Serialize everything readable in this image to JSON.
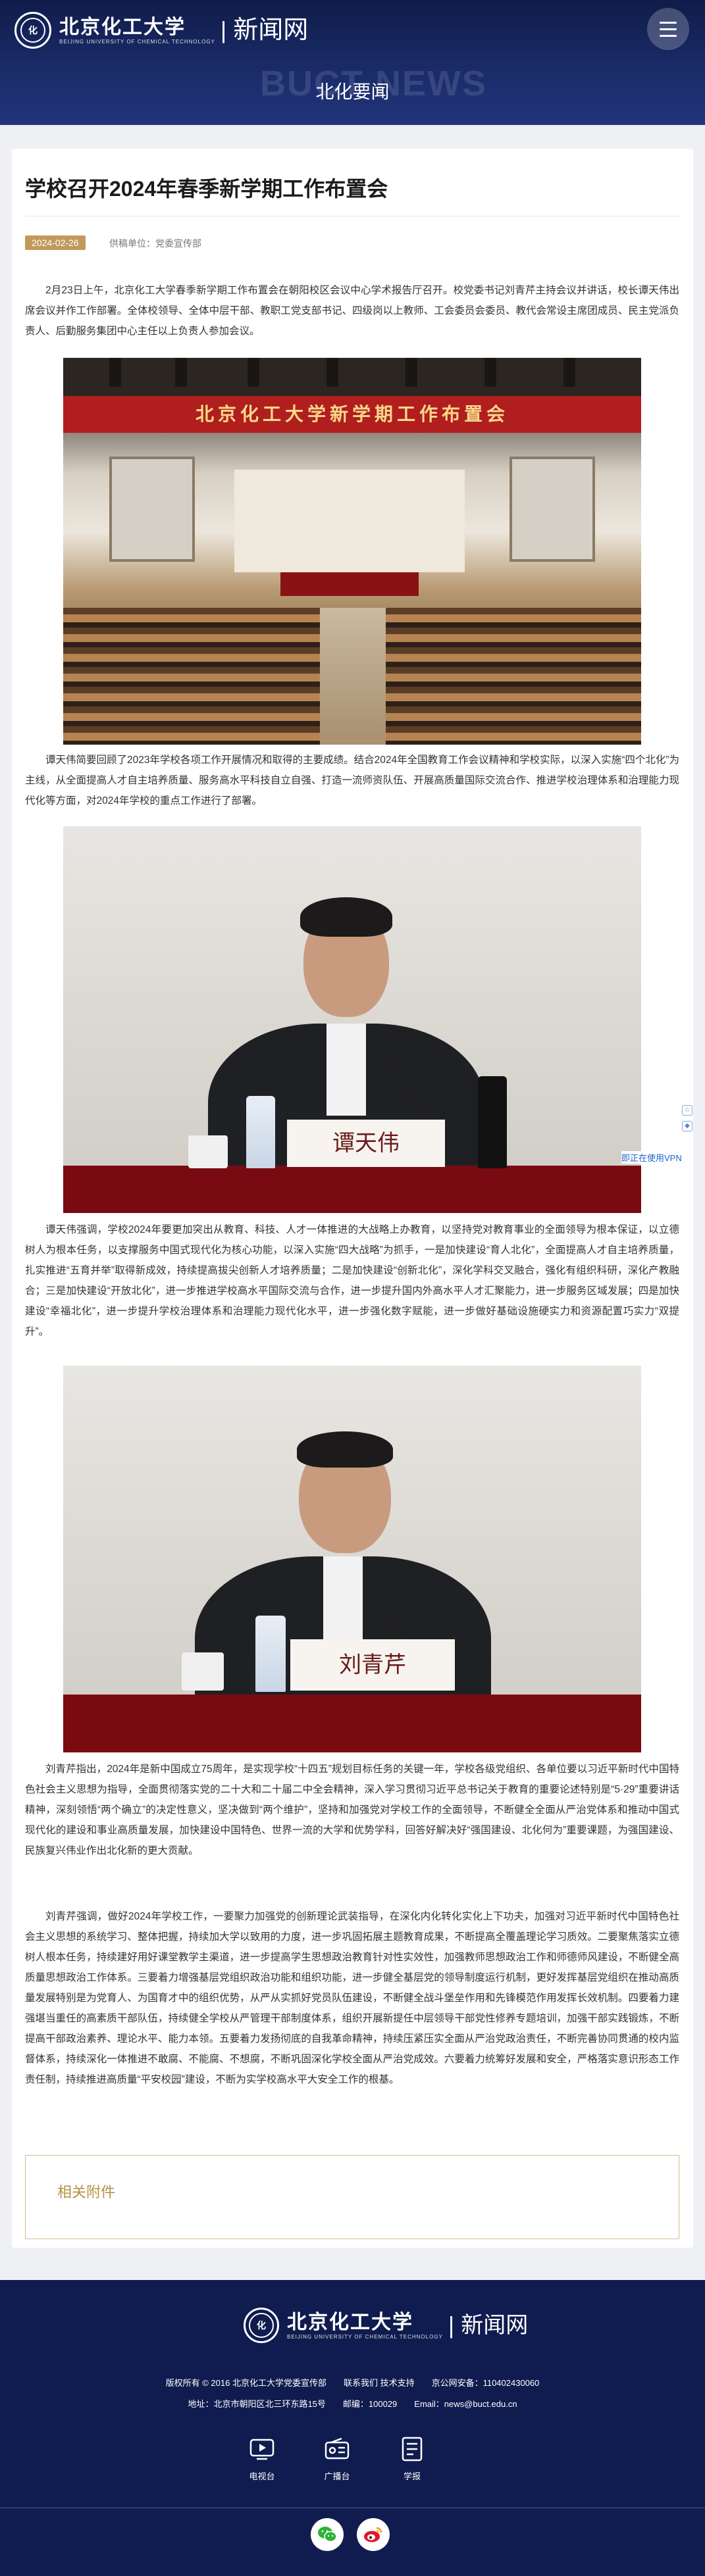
{
  "header": {
    "logo_cn": "北京化工大学",
    "logo_en": "BEIJING UNIVERSITY OF CHEMICAL TECHNOLOGY",
    "site_name": "新闻网",
    "watermark": "BUCT NEWS",
    "section_title": "北化要闻"
  },
  "article": {
    "title": "学校召开2024年春季新学期工作布置会",
    "date": "2024-02-26",
    "source": "供稿单位：党委宣传部",
    "paragraphs": [
      "2月23日上午，北京化工大学春季新学期工作布置会在朝阳校区会议中心学术报告厅召开。校党委书记刘青芹主持会议并讲话，校长谭天伟出席会议并作工作部署。全体校领导、全体中层干部、教职工党支部书记、四级岗以上教师、工会委员会委员、教代会常设主席团成员、民主党派负责人、后勤服务集团中心主任以上负责人参加会议。",
      "谭天伟简要回顾了2023年学校各项工作开展情况和取得的主要成绩。结合2024年全国教育工作会议精神和学校实际，以深入实施“四个北化”为主线，从全面提高人才自主培养质量、服务高水平科技自立自强、打造一流师资队伍、开展高质量国际交流合作、推进学校治理体系和治理能力现代化等方面，对2024年学校的重点工作进行了部署。",
      "谭天伟强调，学校2024年要更加突出从教育、科技、人才一体推进的大战略上办教育，以坚持党对教育事业的全面领导为根本保证，以立德树人为根本任务，以支撑服务中国式现代化为核心功能，以深入实施“四大战略”为抓手，一是加快建设“育人北化”，全面提高人才自主培养质量，扎实推进“五育并举”取得新成效，持续提高拔尖创新人才培养质量；二是加快建设“创新北化”，深化学科交叉融合，强化有组织科研，深化产教融合；三是加快建设“开放北化”，进一步推进学校高水平国际交流与合作，进一步提升国内外高水平人才汇聚能力，进一步服务区域发展；四是加快建设“幸福北化”，进一步提升学校治理体系和治理能力现代化水平，进一步强化数字赋能，进一步做好基础设施硬实力和资源配置巧实力“双提升”。",
      "刘青芹指出，2024年是新中国成立75周年，是实现学校“十四五”规划目标任务的关键一年，学校各级党组织、各单位要以习近平新时代中国特色社会主义思想为指导，全面贯彻落实党的二十大和二十届二中全会精神，深入学习贯彻习近平总书记关于教育的重要论述特别是“5·29”重要讲话精神，深刻领悟“两个确立”的决定性意义，坚决做到“两个维护”，坚持和加强党对学校工作的全面领导，不断健全全面从严治党体系和推动中国式现代化的建设和事业高质量发展，加快建设中国特色、世界一流的大学和优势学科，回答好解决好“强国建设、北化何为”重要课题，为强国建设、民族复兴伟业作出北化新的更大贡献。",
      "刘青芹强调，做好2024年学校工作，一要聚力加强党的创新理论武装指导，在深化内化转化实化上下功夫，加强对习近平新时代中国特色社会主义思想的系统学习、整体把握，持续加大学以致用的力度，进一步巩固拓展主题教育成果，不断提高全覆盖理论学习质效。二要聚焦落实立德树人根本任务，持续建好用好课堂教学主渠道，进一步提高学生思想政治教育针对性实效性，加强教师思想政治工作和师德师风建设，不断健全高质量思想政治工作体系。三要着力增强基层党组织政治功能和组织功能，进一步健全基层党的领导制度运行机制，更好发挥基层党组织在推动高质量发展特别是为党育人、为国育才中的组织优势，从严从实抓好党员队伍建设，不断健全战斗堡垒作用和先锋模范作用发挥长效机制。四要着力建强堪当重任的高素质干部队伍，持续健全学校从严管理干部制度体系，组织开展新提任中层领导干部党性修养专题培训，加强干部实践锻炼，不断提高干部政治素养、理论水平、能力本领。五要着力发扬彻底的自我革命精神，持续压紧压实全面从严治党政治责任，不断完善协同贯通的校内监督体系，持续深化一体推进不敢腐、不能腐、不想腐，不断巩固深化学校全面从严治党成效。六要着力统筹好发展和安全，严格落实意识形态工作责任制，持续推进高质量“平安校园”建设，不断为实学校高水平大安全工作的根基。"
    ],
    "hall_banner": "北京化工大学新学期工作布置会",
    "speaker1_nameplate": "谭天伟",
    "speaker2_nameplate": "刘青芹",
    "attachments_title": "相关附件"
  },
  "side": {
    "vpn_label": "即正在使用VPN"
  },
  "footer": {
    "logo_cn": "北京化工大学",
    "logo_en": "BEIJING UNIVERSITY OF CHEMICAL TECHNOLOGY",
    "site_name": "新闻网",
    "copyright": "版权所有 © 2016 北京化工大学党委宣传部　　联系我们 技术支持　　京公网安备：110402430060",
    "address": "地址：北京市朝阳区北三环东路15号　　邮编：100029　　Email：news@buct.edu.cn",
    "media": [
      {
        "label": "电视台",
        "icon": "tv-icon"
      },
      {
        "label": "广播台",
        "icon": "radio-icon"
      },
      {
        "label": "学报",
        "icon": "journal-icon"
      }
    ],
    "social": [
      {
        "icon": "wechat-icon"
      },
      {
        "icon": "weibo-icon"
      }
    ]
  },
  "colors": {
    "header_bg": "#1b2c6b",
    "footer_bg": "#101c4f",
    "accent_gold": "#c19a5b",
    "desk_red": "#7a0a12"
  }
}
